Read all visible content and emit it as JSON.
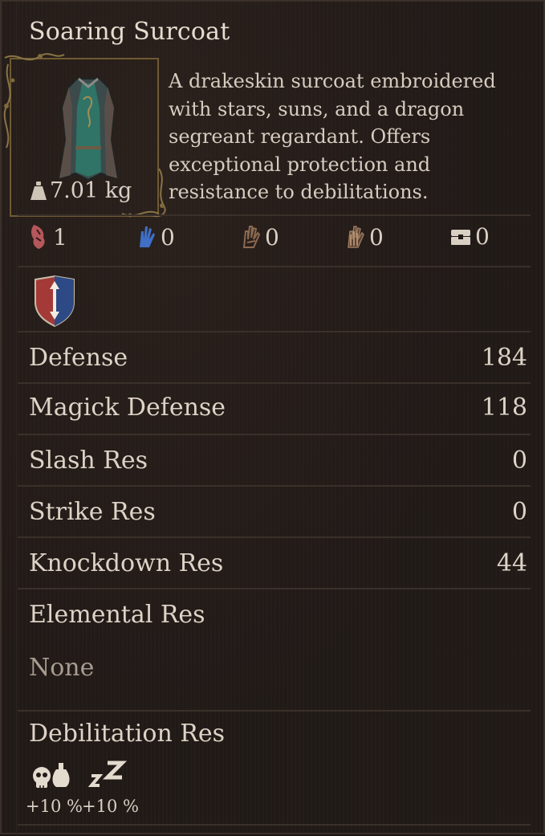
{
  "item": {
    "name": "Soaring Surcoat",
    "description_lines": [
      "A drakeskin surcoat embroidered",
      "with stars, suns, and a dragon",
      "segreant regardant. Offers",
      "exceptional protection and",
      "resistance to debilitations."
    ],
    "weight": "7.01 kg",
    "icon": "surcoat-armor-icon"
  },
  "vocation_counts": [
    {
      "icon": "red-claw-icon",
      "value": "1",
      "color": "#b5575b"
    },
    {
      "icon": "blue-hand-icon",
      "value": "0",
      "color": "#3f6fc6"
    },
    {
      "icon": "brown-hand-icon",
      "value": "0",
      "color": "#8c6a4f"
    },
    {
      "icon": "striped-hand-icon",
      "value": "0",
      "color": "#9a7a5f"
    },
    {
      "icon": "chest-icon",
      "value": "0",
      "color": "#d9cfc3"
    }
  ],
  "category_icon": "shield-crest-icon",
  "stats": [
    {
      "label": "Defense",
      "value": "184"
    },
    {
      "label": "Magick Defense",
      "value": "118"
    },
    {
      "label": "Slash Res",
      "value": "0"
    },
    {
      "label": "Strike Res",
      "value": "0"
    },
    {
      "label": "Knockdown Res",
      "value": "44"
    }
  ],
  "elemental": {
    "label": "Elemental Res",
    "value": "None"
  },
  "debilitation": {
    "label": "Debilitation Res",
    "items": [
      {
        "icon": "poison-skull-icon",
        "value": "+10 %"
      },
      {
        "icon": "sleep-zz-icon",
        "value": "+10 %"
      }
    ]
  }
}
